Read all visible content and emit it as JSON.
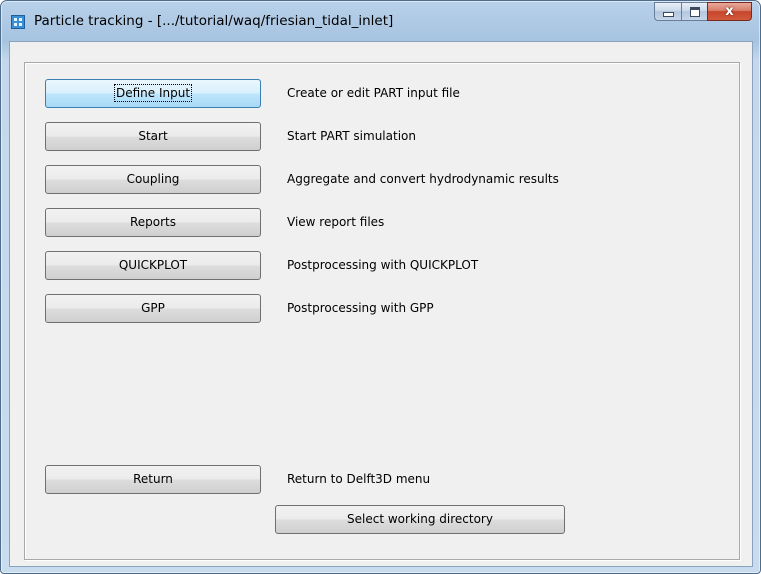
{
  "window": {
    "title": "Particle tracking - [.../tutorial/waq/friesian_tidal_inlet]",
    "app_icon": "app-grid-icon",
    "caption_buttons": {
      "minimize": "minimize-icon",
      "maximize": "maximize-icon",
      "close_glyph": "x"
    }
  },
  "menu": [
    {
      "button": "Define Input",
      "description": "Create or edit PART input file"
    },
    {
      "button": "Start",
      "description": "Start PART simulation"
    },
    {
      "button": "Coupling",
      "description": "Aggregate and convert hydrodynamic results"
    },
    {
      "button": "Reports",
      "description": "View report files"
    },
    {
      "button": "QUICKPLOT",
      "description": "Postprocessing with QUICKPLOT"
    },
    {
      "button": "GPP",
      "description": "Postprocessing with GPP"
    }
  ],
  "return_item": {
    "button": "Return",
    "description": "Return to Delft3D menu"
  },
  "select_dir_button": "Select working directory",
  "colors": {
    "title_bar": "#b9d1ea",
    "client_bg": "#f0f0f0",
    "focused_button": "#bee6fd",
    "close_button": "#c7452c"
  }
}
